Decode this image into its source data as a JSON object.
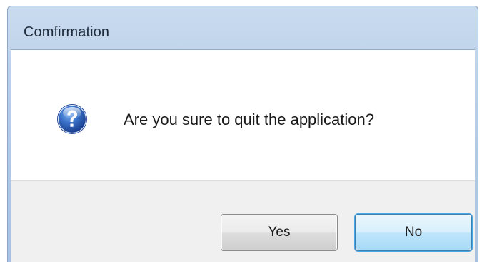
{
  "window": {
    "title": "Comfirmation"
  },
  "dialog": {
    "message": "Are you sure to quit the application?",
    "icon": "question-icon"
  },
  "buttons": {
    "yes_label": "Yes",
    "no_label": "No"
  },
  "colors": {
    "title_bar": "#b6cce6",
    "icon_blue": "#2456a8",
    "footer": "#f0f0f0",
    "default_button_border": "#3c7fb1"
  }
}
